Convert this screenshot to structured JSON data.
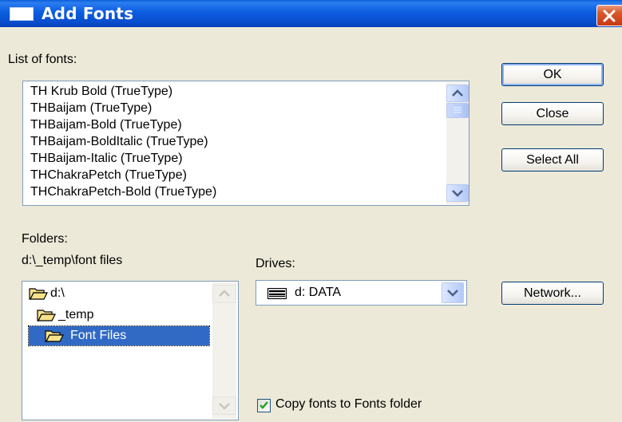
{
  "window": {
    "title": "Add Fonts"
  },
  "fonts_list": {
    "label": "List of fonts:",
    "items": [
      "TH Krub Bold (TrueType)",
      "THBaijam (TrueType)",
      "THBaijam-Bold (TrueType)",
      "THBaijam-BoldItalic (TrueType)",
      "THBaijam-Italic (TrueType)",
      "THChakraPetch (TrueType)",
      "THChakraPetch-Bold (TrueType)"
    ]
  },
  "buttons": {
    "ok": "OK",
    "close": "Close",
    "select_all": "Select All",
    "network": "Network..."
  },
  "folders": {
    "label": "Folders:",
    "current_path": "d:\\_temp\\font files",
    "items": [
      {
        "name": "d:\\",
        "icon": "open-folder-icon",
        "selected": false
      },
      {
        "name": "_temp",
        "icon": "open-folder-icon",
        "selected": false
      },
      {
        "name": "Font Files",
        "icon": "open-folder-icon",
        "selected": true
      }
    ]
  },
  "drives": {
    "label": "Drives:",
    "selected": "d: DATA",
    "icon": "hard-drive-icon"
  },
  "options": {
    "copy_fonts_label": "Copy fonts to Fonts folder",
    "copy_fonts_checked": true
  },
  "colors": {
    "titlebar": "#0a5fd8",
    "selection": "#316ac5",
    "dialog_bg": "#ece9d8",
    "close_button": "#d9582c"
  }
}
